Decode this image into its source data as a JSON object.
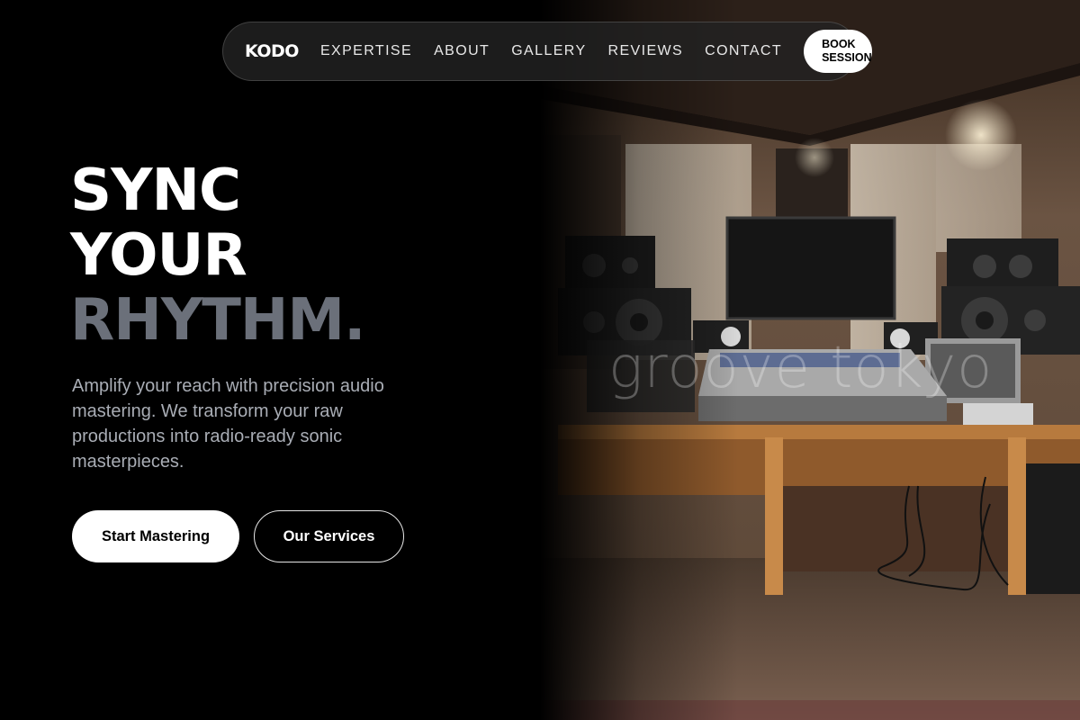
{
  "nav": {
    "logo": "KODO",
    "links": [
      "EXPERTISE",
      "ABOUT",
      "GALLERY",
      "REVIEWS",
      "CONTACT"
    ],
    "cta_line1": "BOOK",
    "cta_line2": "SESSION"
  },
  "hero": {
    "headline_line1": "SYNC",
    "headline_line2": "YOUR",
    "headline_line3": "RHYTHM.",
    "subtitle": "Amplify your reach with precision audio mastering. We transform your raw productions into radio-ready sonic masterpieces.",
    "primary_button": "Start Mastering",
    "secondary_button": "Our Services"
  },
  "image": {
    "watermark": "groove tokyo"
  },
  "colors": {
    "background": "#000000",
    "headline": "#ffffff",
    "headline_accent": "#6b707a",
    "subtitle": "#a9adb5",
    "button_bg": "#ffffff",
    "button_text": "#000000"
  }
}
